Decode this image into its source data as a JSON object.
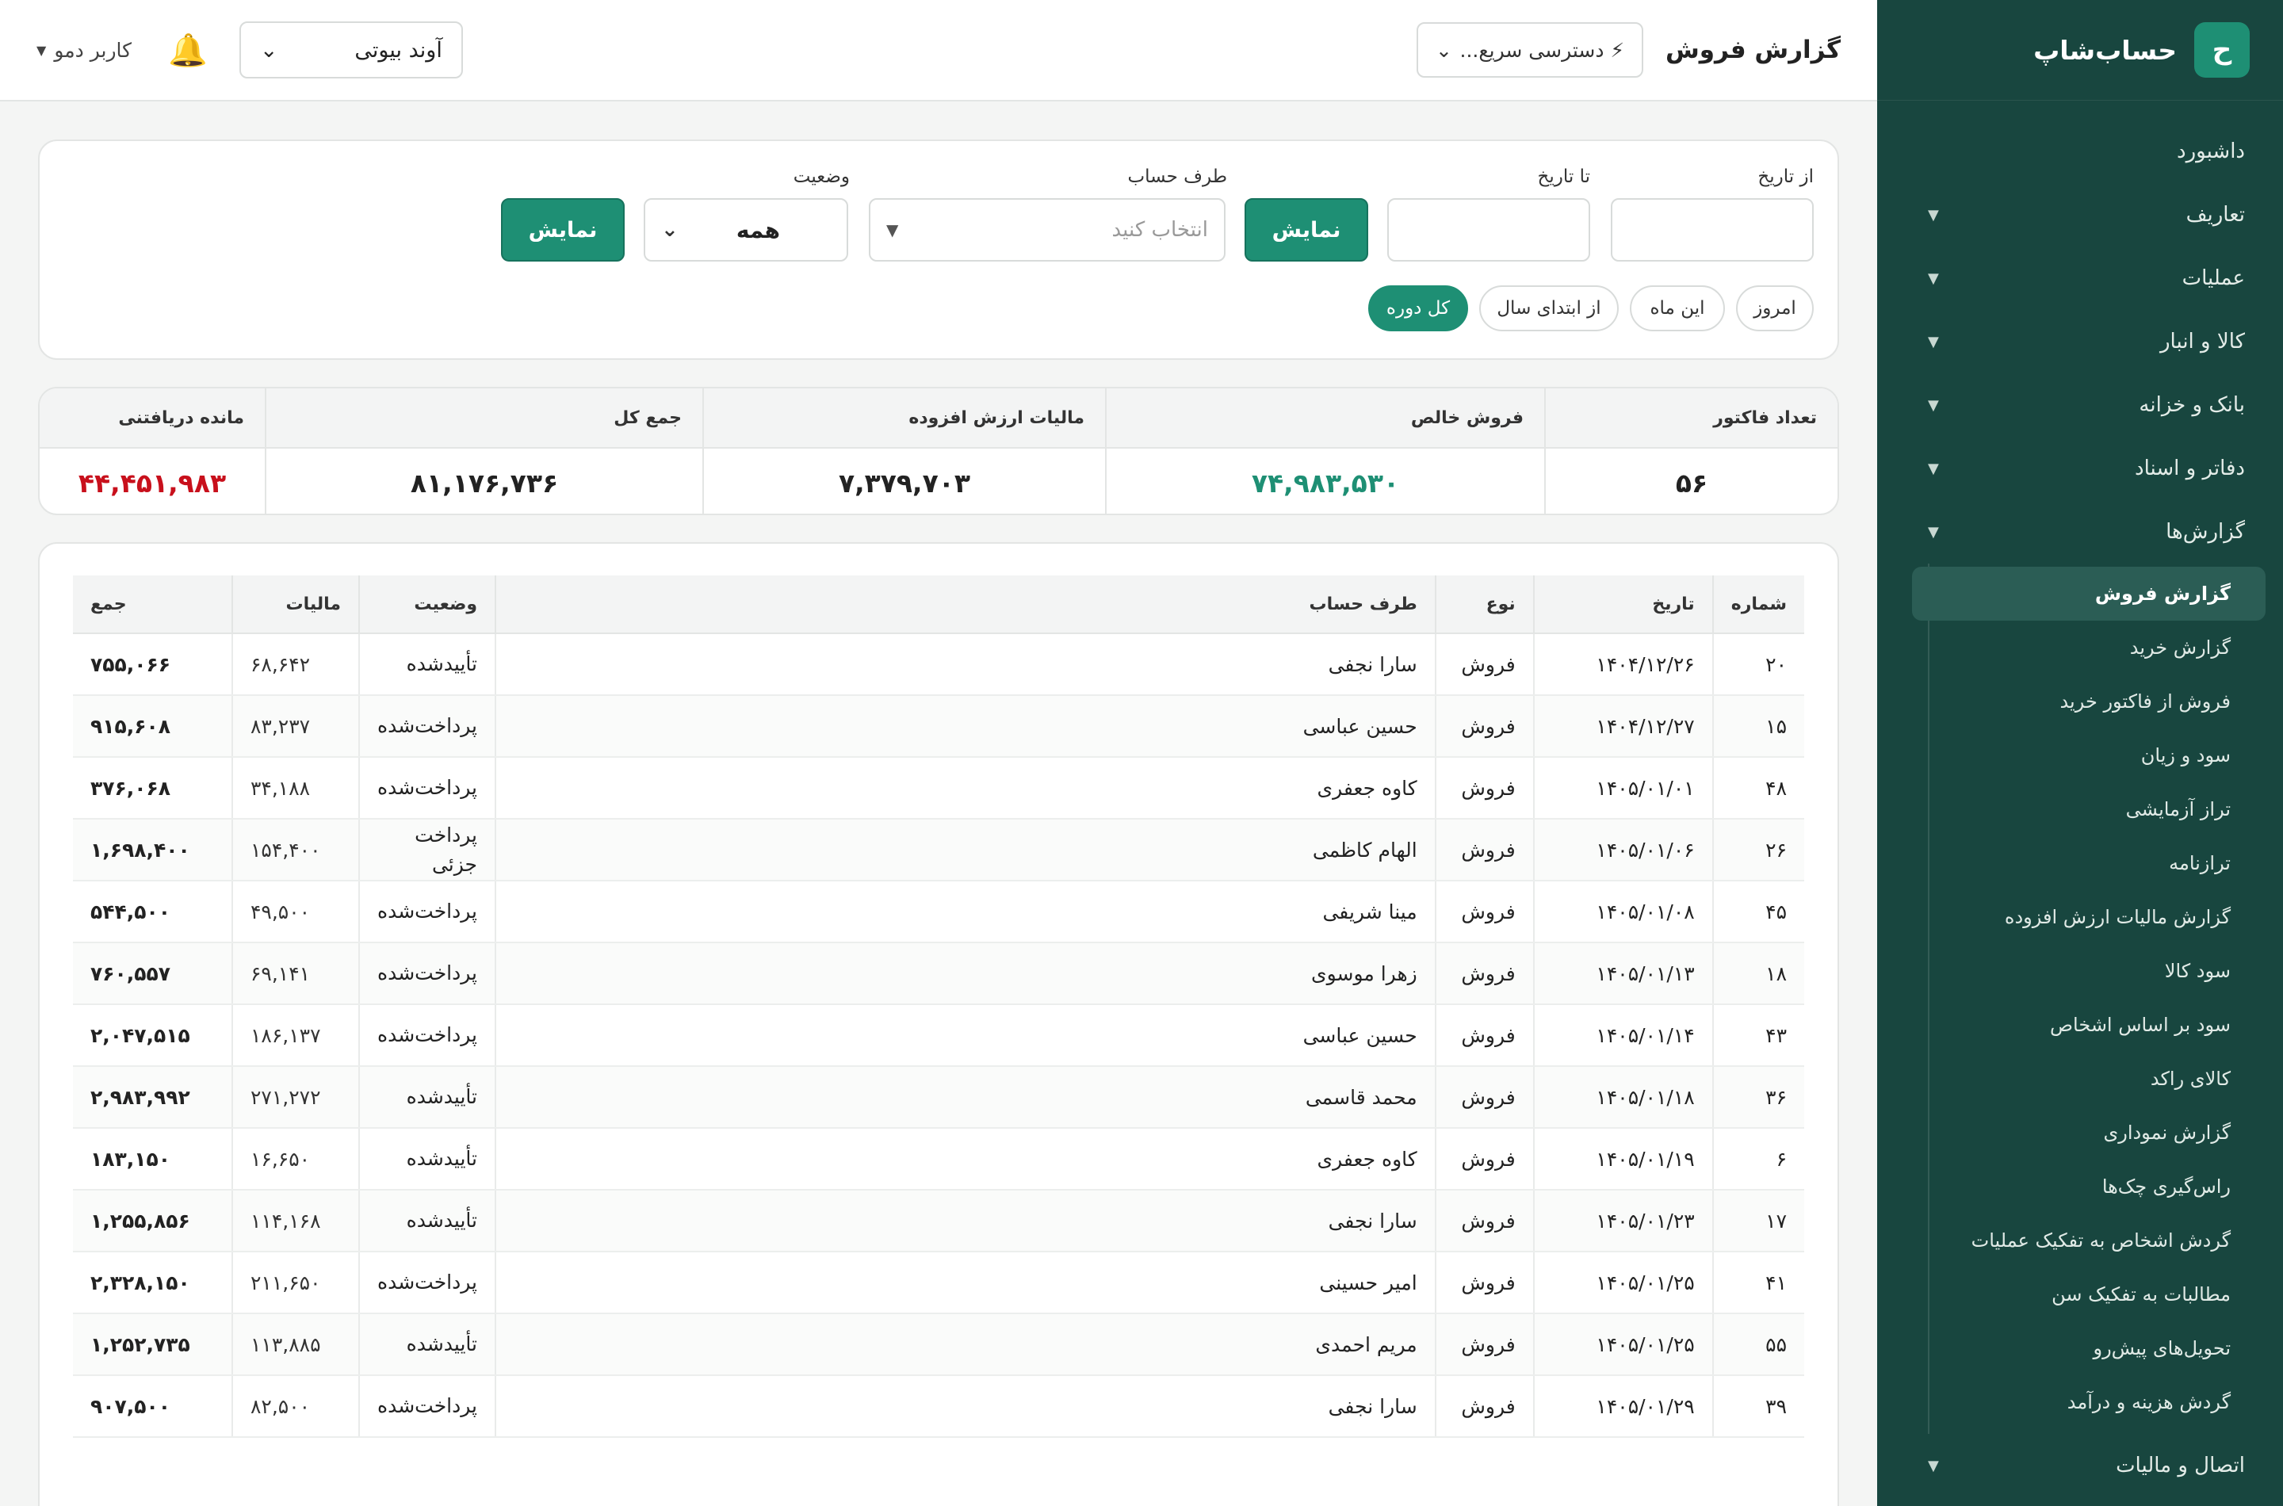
{
  "sidebar": {
    "logo_letter": "ح",
    "brand": "حساب‌شاپ",
    "items": [
      {
        "label": "داشبورد",
        "caret": ""
      },
      {
        "label": "تعاریف",
        "caret": "▼"
      },
      {
        "label": "عملیات",
        "caret": "▼"
      },
      {
        "label": "کالا و انبار",
        "caret": "▼"
      },
      {
        "label": "بانک و خزانه",
        "caret": "▼"
      },
      {
        "label": "دفاتر و اسناد",
        "caret": "▼"
      },
      {
        "label": "گزارش‌ها",
        "caret": "▼"
      }
    ],
    "reports": [
      "گزارش فروش",
      "گزارش خرید",
      "فروش از فاکتور خرید",
      "سود و زیان",
      "تراز آزمایشی",
      "ترازنامه",
      "گزارش مالیات ارزش افزوده",
      "سود کالا",
      "سود بر اساس اشخاص",
      "کالای راکد",
      "گزارش نموداری",
      "راس‌گیری چک‌ها",
      "گردش اشخاص به تفکیک عملیات",
      "مطالبات به تفکیک سن",
      "تحویل‌های پیش‌رو",
      "گردش هزینه و درآمد"
    ],
    "bottom_item": {
      "label": "اتصال و مالیات",
      "caret": "▼"
    }
  },
  "header": {
    "title": "گزارش فروش",
    "quick_access": "⚡ دسترسی سریع...",
    "company": "آوند بیوتی",
    "user": "کاربر دمو"
  },
  "filters": {
    "from_label": "از تاریخ",
    "to_label": "تا تاریخ",
    "show1": "نمایش",
    "party_label": "طرف حساب",
    "party_placeholder": "انتخاب کنید",
    "status_label": "وضعیت",
    "status_value": "همه",
    "show2": "نمایش",
    "pills": [
      "امروز",
      "این ماه",
      "از ابتدای سال",
      "کل دوره"
    ]
  },
  "summary": {
    "headers": [
      "تعداد فاکتور",
      "فروش خالص",
      "مالیات ارزش افزوده",
      "جمع کل",
      "مانده دریافتنی"
    ],
    "values": [
      "۵۶",
      "۷۴,۹۸۳,۵۳۰",
      "۷,۳۷۹,۷۰۳",
      "۸۱,۱۷۶,۷۳۶",
      "۴۴,۴۵۱,۹۸۳"
    ]
  },
  "table": {
    "headers": [
      "شماره",
      "تاریخ",
      "نوع",
      "طرف حساب",
      "وضعیت",
      "مالیات",
      "جمع"
    ],
    "rows": [
      [
        "۲۰",
        "۱۴۰۴/۱۲/۲۶",
        "فروش",
        "سارا نجفی",
        "تأییدشده",
        "۶۸,۶۴۲",
        "۷۵۵,۰۶۶"
      ],
      [
        "۱۵",
        "۱۴۰۴/۱۲/۲۷",
        "فروش",
        "حسین عباسی",
        "پرداخت‌شده",
        "۸۳,۲۳۷",
        "۹۱۵,۶۰۸"
      ],
      [
        "۴۸",
        "۱۴۰۵/۰۱/۰۱",
        "فروش",
        "کاوه جعفری",
        "پرداخت‌شده",
        "۳۴,۱۸۸",
        "۳۷۶,۰۶۸"
      ],
      [
        "۲۶",
        "۱۴۰۵/۰۱/۰۶",
        "فروش",
        "الهام کاظمی",
        "پرداخت جزئی",
        "۱۵۴,۴۰۰",
        "۱,۶۹۸,۴۰۰"
      ],
      [
        "۴۵",
        "۱۴۰۵/۰۱/۰۸",
        "فروش",
        "مینا شریفی",
        "پرداخت‌شده",
        "۴۹,۵۰۰",
        "۵۴۴,۵۰۰"
      ],
      [
        "۱۸",
        "۱۴۰۵/۰۱/۱۳",
        "فروش",
        "زهرا موسوی",
        "پرداخت‌شده",
        "۶۹,۱۴۱",
        "۷۶۰,۵۵۷"
      ],
      [
        "۴۳",
        "۱۴۰۵/۰۱/۱۴",
        "فروش",
        "حسین عباسی",
        "پرداخت‌شده",
        "۱۸۶,۱۳۷",
        "۲,۰۴۷,۵۱۵"
      ],
      [
        "۳۶",
        "۱۴۰۵/۰۱/۱۸",
        "فروش",
        "محمد قاسمی",
        "تأییدشده",
        "۲۷۱,۲۷۲",
        "۲,۹۸۳,۹۹۲"
      ],
      [
        "۶",
        "۱۴۰۵/۰۱/۱۹",
        "فروش",
        "کاوه جعفری",
        "تأییدشده",
        "۱۶,۶۵۰",
        "۱۸۳,۱۵۰"
      ],
      [
        "۱۷",
        "۱۴۰۵/۰۱/۲۳",
        "فروش",
        "سارا نجفی",
        "تأییدشده",
        "۱۱۴,۱۶۸",
        "۱,۲۵۵,۸۵۶"
      ],
      [
        "۴۱",
        "۱۴۰۵/۰۱/۲۵",
        "فروش",
        "امیر حسینی",
        "پرداخت‌شده",
        "۲۱۱,۶۵۰",
        "۲,۳۲۸,۱۵۰"
      ],
      [
        "۵۵",
        "۱۴۰۵/۰۱/۲۵",
        "فروش",
        "مریم احمدی",
        "تأییدشده",
        "۱۱۳,۸۸۵",
        "۱,۲۵۲,۷۳۵"
      ],
      [
        "۳۹",
        "۱۴۰۵/۰۱/۲۹",
        "فروش",
        "سارا نجفی",
        "پرداخت‌شده",
        "۸۲,۵۰۰",
        "۹۰۷,۵۰۰"
      ]
    ]
  }
}
